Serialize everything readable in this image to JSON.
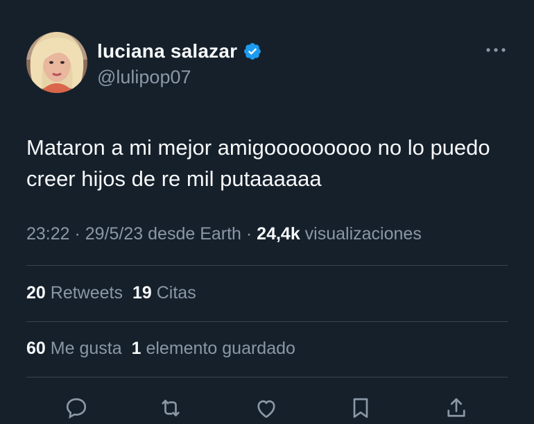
{
  "author": {
    "name": "luciana salazar",
    "handle": "@lulipop07",
    "verified_icon": "verified-badge-icon",
    "verified_color": "#1d9bf0"
  },
  "tweet": {
    "text": "Mataron a mi mejor amigooooooooo no lo puedo creer hijos de re mil putaaaaaa"
  },
  "meta": {
    "timestamp": "23:22 · 29/5/23 desde Earth · ",
    "views_count": "24,4k",
    "views_label": " visualizaciones"
  },
  "stats": {
    "retweets_count": "20",
    "retweets_label": "Retweets",
    "quotes_count": "19",
    "quotes_label": "Citas",
    "likes_count": "60",
    "likes_label": "Me gusta",
    "bookmarks_count": "1",
    "bookmarks_label": "elemento guardado"
  },
  "actions": [
    "reply-icon",
    "retweet-icon",
    "like-icon",
    "bookmark-icon",
    "share-icon"
  ],
  "colors": {
    "background": "#15202b",
    "primary_text": "#f7f9f9",
    "secondary_text": "#8b98a5",
    "divider": "#38444d"
  }
}
